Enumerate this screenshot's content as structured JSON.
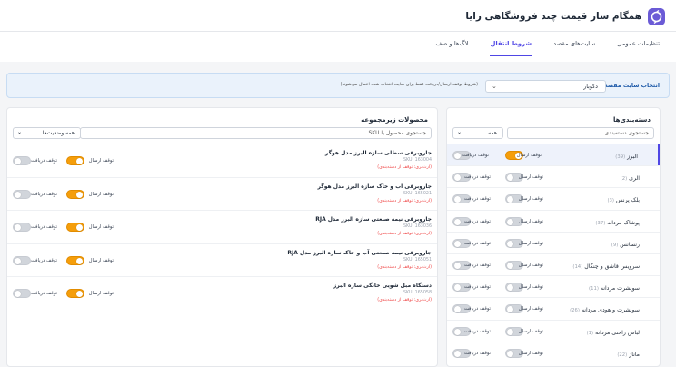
{
  "app": {
    "title": "همگام ساز قیمت چند فروشگاهی رایا"
  },
  "tabs": [
    {
      "label": "تنظیمات عمومی",
      "active": false
    },
    {
      "label": "سایت‌های مقصد",
      "active": false
    },
    {
      "label": "شروط انتقال",
      "active": true
    },
    {
      "label": "لاگ‌ها و صف",
      "active": false
    }
  ],
  "destination": {
    "label": "انتخاب سایت مقصد:",
    "value": "دکوبار",
    "note": "(شروط توقف ارسال/دریافت فقط برای سایت انتخاب شده اعمال می‌شوند)"
  },
  "categories": {
    "title": "دسته‌بندی‌ها",
    "search_placeholder": "جستجوی دسته‌بندی...",
    "filter_value": "همه",
    "send_label": "توقف ارسال",
    "receive_label": "توقف دریافت",
    "items": [
      {
        "name": "البرز",
        "count": "(39)",
        "send": true,
        "receive": false,
        "active": true
      },
      {
        "name": "الری",
        "count": "(2)",
        "send": false,
        "receive": false
      },
      {
        "name": "بلک پرنس",
        "count": "(3)",
        "send": false,
        "receive": false
      },
      {
        "name": "پوشاک مردانه",
        "count": "(37)",
        "send": false,
        "receive": false
      },
      {
        "name": "رنسانس",
        "count": "(9)",
        "send": false,
        "receive": false
      },
      {
        "name": "سرویس قاشق و چنگال",
        "count": "(14)",
        "send": false,
        "receive": false
      },
      {
        "name": "سویشرت مردانه",
        "count": "(11)",
        "send": false,
        "receive": false
      },
      {
        "name": "سویشرت و هودی مردانه",
        "count": "(26)",
        "send": false,
        "receive": false
      },
      {
        "name": "لباس راحتی مردانه",
        "count": "(1)",
        "send": false,
        "receive": false
      },
      {
        "name": "ماناژ",
        "count": "(22)",
        "send": false,
        "receive": false
      }
    ]
  },
  "products": {
    "title": "محصولات زیرمجموعه",
    "search_placeholder": "جستجوی محصول یا SKU...",
    "filter_value": "همه وضعیت‌ها",
    "send_label": "توقف ارسال",
    "receive_label": "توقف دریافت",
    "items": [
      {
        "name": "جاروبرقی سطلی سازه البرز مدل هوگر",
        "sku": "SKU: 163004",
        "inherit": "(ارث‌بری: توقف از دسته‌بندی)",
        "send": true,
        "receive": false
      },
      {
        "name": "جاروبرقی آب و خاک سازه البرز مدل هوگر",
        "sku": "SKU: 165021",
        "inherit": "(ارث‌بری: توقف از دسته‌بندی)",
        "send": true,
        "receive": false
      },
      {
        "name": "جاروبرقی نیمه صنعتی سازه البرز مدل RJA",
        "sku": "SKU: 163036",
        "inherit": "(ارث‌بری: توقف از دسته‌بندی)",
        "send": true,
        "receive": false
      },
      {
        "name": "جاروبرقی نیمه صنعتی آب و خاک سازه البرز مدل RJA",
        "sku": "SKU: 165051",
        "inherit": "(ارث‌بری: توقف از دسته‌بندی)",
        "send": true,
        "receive": false
      },
      {
        "name": "دستگاه مبل شویی خانگی سازه البرز",
        "sku": "SKU: 165058",
        "inherit": "(ارث‌بری: توقف از دسته‌بندی)",
        "send": true,
        "receive": false
      }
    ]
  },
  "colors": {
    "accent": "#4f46e5",
    "toggle_on": "#f59e0b",
    "inherit": "#ef4444"
  }
}
